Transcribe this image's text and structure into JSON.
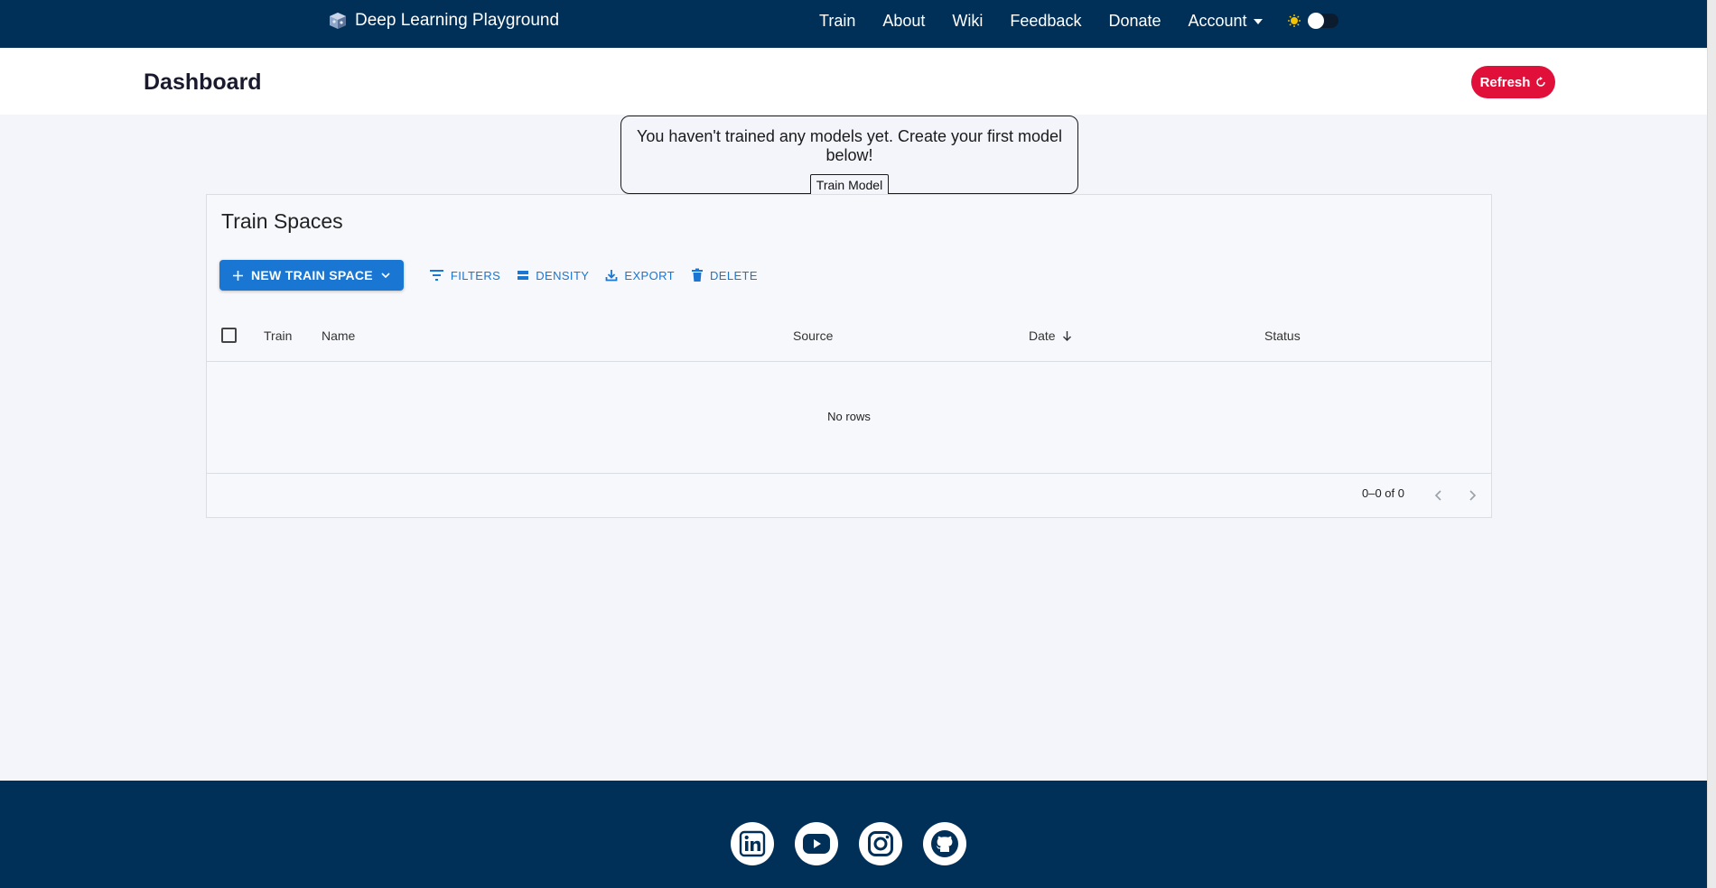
{
  "navbar": {
    "brand": "Deep Learning Playground",
    "links": [
      "Train",
      "About",
      "Wiki",
      "Feedback",
      "Donate"
    ],
    "account_label": "Account",
    "theme": "light"
  },
  "header": {
    "title": "Dashboard",
    "refresh_label": "Refresh"
  },
  "notice": {
    "message": "You haven't trained any models yet. Create your first model below!",
    "button_label": "Train Model"
  },
  "grid": {
    "title": "Train Spaces",
    "toolbar": {
      "new_label": "NEW TRAIN SPACE",
      "filters_label": "FILTERS",
      "density_label": "DENSITY",
      "export_label": "EXPORT",
      "delete_label": "DELETE"
    },
    "columns": [
      "Train",
      "Name",
      "Source",
      "Date",
      "Status"
    ],
    "sort": {
      "column": "Date",
      "direction": "desc"
    },
    "empty_text": "No rows",
    "pagination": "0–0 of 0"
  },
  "footer": {
    "social": [
      "linkedin-icon",
      "youtube-icon",
      "instagram-icon",
      "github-icon"
    ]
  },
  "colors": {
    "nav_bg": "#003058",
    "refresh_bg": "#e0103a",
    "primary": "#1976d2",
    "page_bg": "#f4f5fb"
  }
}
